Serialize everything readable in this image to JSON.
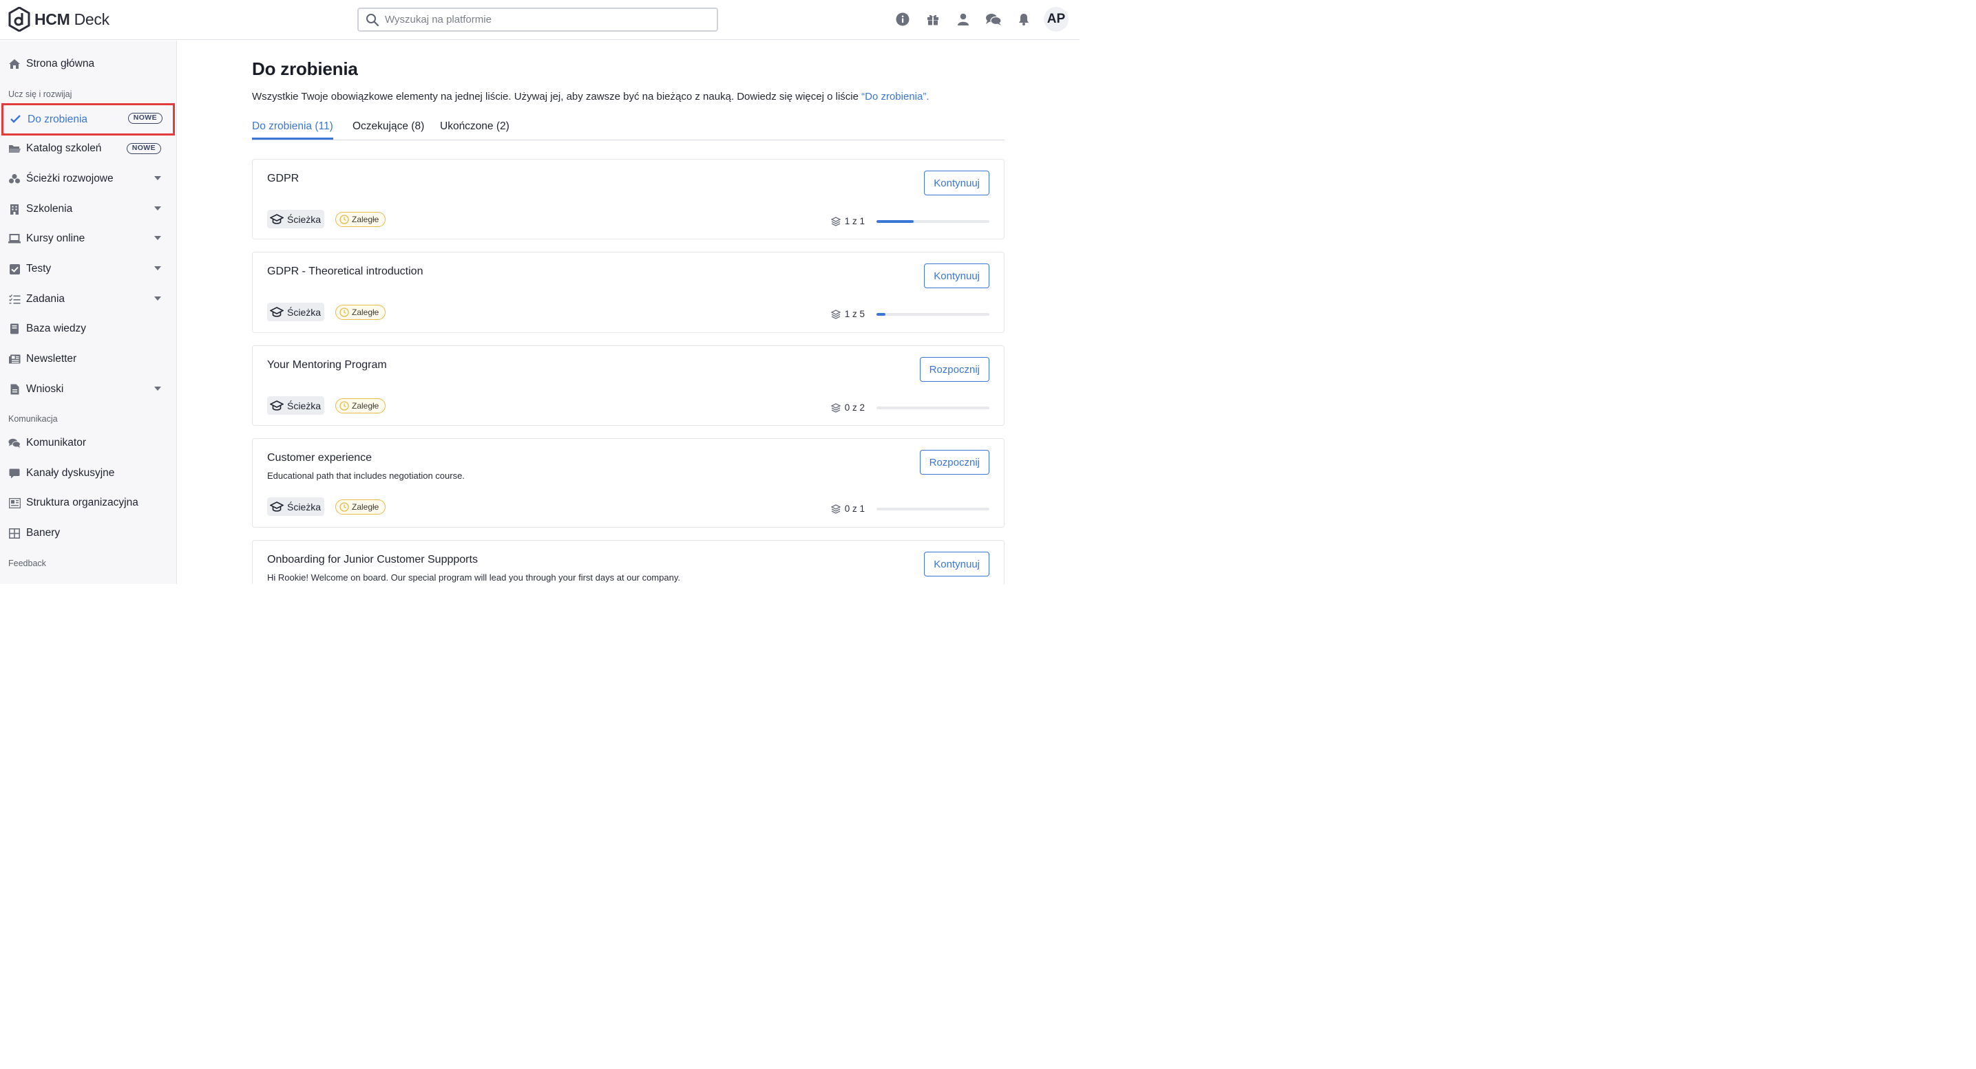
{
  "app": {
    "logo_text_bold": "HCM",
    "logo_text_light": "Deck"
  },
  "search": {
    "placeholder": "Wyszukaj na platformie",
    "value": ""
  },
  "header": {
    "avatar_initials": "AP",
    "icons": [
      "info-icon",
      "gift-icon",
      "user-icon",
      "chat-icon",
      "bell-icon"
    ]
  },
  "sidebar": {
    "home": "Strona główna",
    "section_learn": "Ucz się i rozwijaj",
    "section_comm": "Komunikacja",
    "section_feedback": "Feedback",
    "badge_new": "NOWE",
    "items": [
      {
        "label": "Do zrobienia",
        "icon": "check-icon"
      },
      {
        "label": "Katalog szkoleń",
        "icon": "folder-icon"
      },
      {
        "label": "Ścieżki rozwojowe",
        "icon": "paths-icon"
      },
      {
        "label": "Szkolenia",
        "icon": "building-icon"
      },
      {
        "label": "Kursy online",
        "icon": "laptop-icon"
      },
      {
        "label": "Testy",
        "icon": "checkbox-icon"
      },
      {
        "label": "Zadania",
        "icon": "tasks-icon"
      },
      {
        "label": "Baza wiedzy",
        "icon": "book-icon"
      },
      {
        "label": "Newsletter",
        "icon": "newspaper-icon"
      },
      {
        "label": "Wnioski",
        "icon": "document-icon"
      },
      {
        "label": "Komunikator",
        "icon": "chat-icon"
      },
      {
        "label": "Kanały dyskusyjne",
        "icon": "message-icon"
      },
      {
        "label": "Struktura organizacyjna",
        "icon": "org-icon"
      },
      {
        "label": "Banery",
        "icon": "grid-icon"
      }
    ]
  },
  "main": {
    "title": "Do zrobienia",
    "description": "Wszystkie Twoje obowiązkowe elementy na jednej liście. Używaj jej, aby zawsze być na bieżąco z nauką. Dowiedz się więcej o liście ",
    "description_link": "“Do zrobienia”.",
    "tabs": [
      {
        "label": "Do zrobienia (11)"
      },
      {
        "label": "Oczekujące (8)"
      },
      {
        "label": "Ukończone (2)"
      }
    ],
    "chip_path": "Ścieżka",
    "chip_late": "Zaległe",
    "cards": [
      {
        "title": "GDPR",
        "subtitle": "",
        "button": "Kontynuuj",
        "progress_text": "1 z 1",
        "progress": 0.33
      },
      {
        "title": "GDPR - Theoretical introduction",
        "subtitle": "",
        "button": "Kontynuuj",
        "progress_text": "1 z 5",
        "progress": 0.08
      },
      {
        "title": "Your Mentoring Program",
        "subtitle": "",
        "button": "Rozpocznij",
        "progress_text": "0 z 2",
        "progress": 0
      },
      {
        "title": "Customer experience",
        "subtitle": "Educational path that includes negotiation course.",
        "button": "Rozpocznij",
        "progress_text": "0 z 1",
        "progress": 0
      },
      {
        "title": "Onboarding for Junior Customer Suppports",
        "subtitle": "Hi Rookie! Welcome on board. Our special program will lead you through your first days at our company.",
        "button": "Kontynuuj",
        "progress_text": "",
        "progress": 0
      }
    ]
  },
  "colors": {
    "accent": "#3a76d6",
    "highlight": "#e23b3b",
    "late": "#e9b949"
  }
}
